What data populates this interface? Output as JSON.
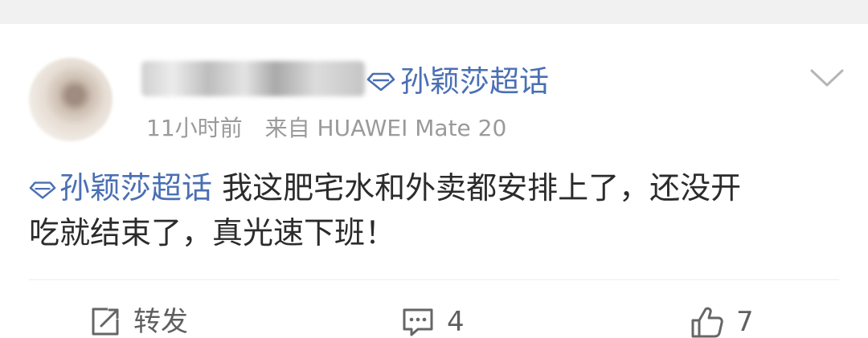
{
  "post": {
    "topic_tag": "孙颖莎超话",
    "time": "11小时前",
    "source": "来自 HUAWEI Mate 20",
    "content": {
      "tag": "孙颖莎超话",
      "line1": "我这肥宅水和外卖都安排上了，还没开",
      "line2": "吃就结束了，真光速下班！"
    }
  },
  "actions": {
    "repost_label": "转发",
    "comment_count": "4",
    "like_count": "7"
  },
  "colors": {
    "topic_link": "#4a6fb3",
    "meta_text": "#9a9a9a",
    "body_text": "#2b2b2b"
  },
  "icons": [
    "diamond-icon",
    "chevron-down-icon",
    "repost-icon",
    "comment-icon",
    "like-icon"
  ]
}
